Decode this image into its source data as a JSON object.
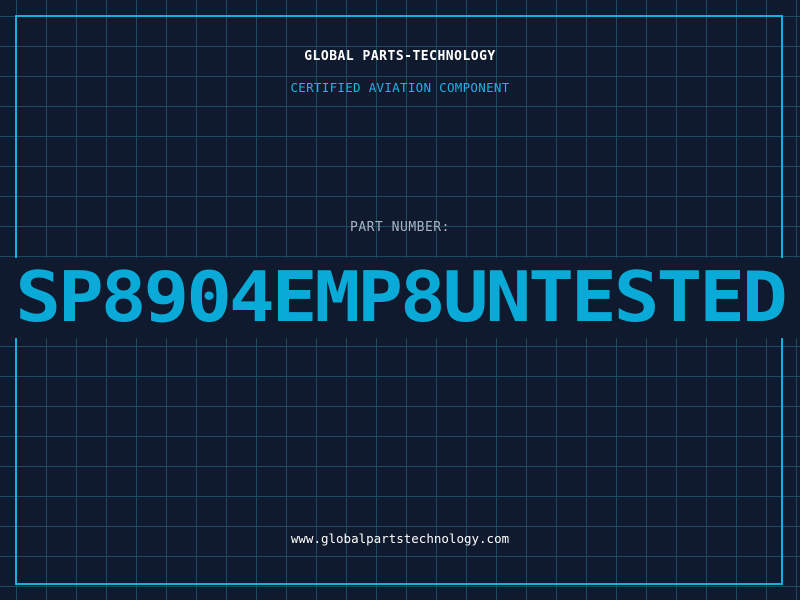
{
  "header": {
    "company": "GLOBAL PARTS-TECHNOLOGY",
    "subtitle": "CERTIFIED AVIATION COMPONENT"
  },
  "part": {
    "label": "PART NUMBER:",
    "number": "SP8904EMP8UNTESTED"
  },
  "footer": {
    "website": "www.globalpartstechnology.com"
  },
  "colors": {
    "background": "#0f1a2e",
    "grid": "#1d4a5e",
    "accent": "#19aee0",
    "text_primary": "#ffffff",
    "text_muted": "#a9b4c4"
  }
}
